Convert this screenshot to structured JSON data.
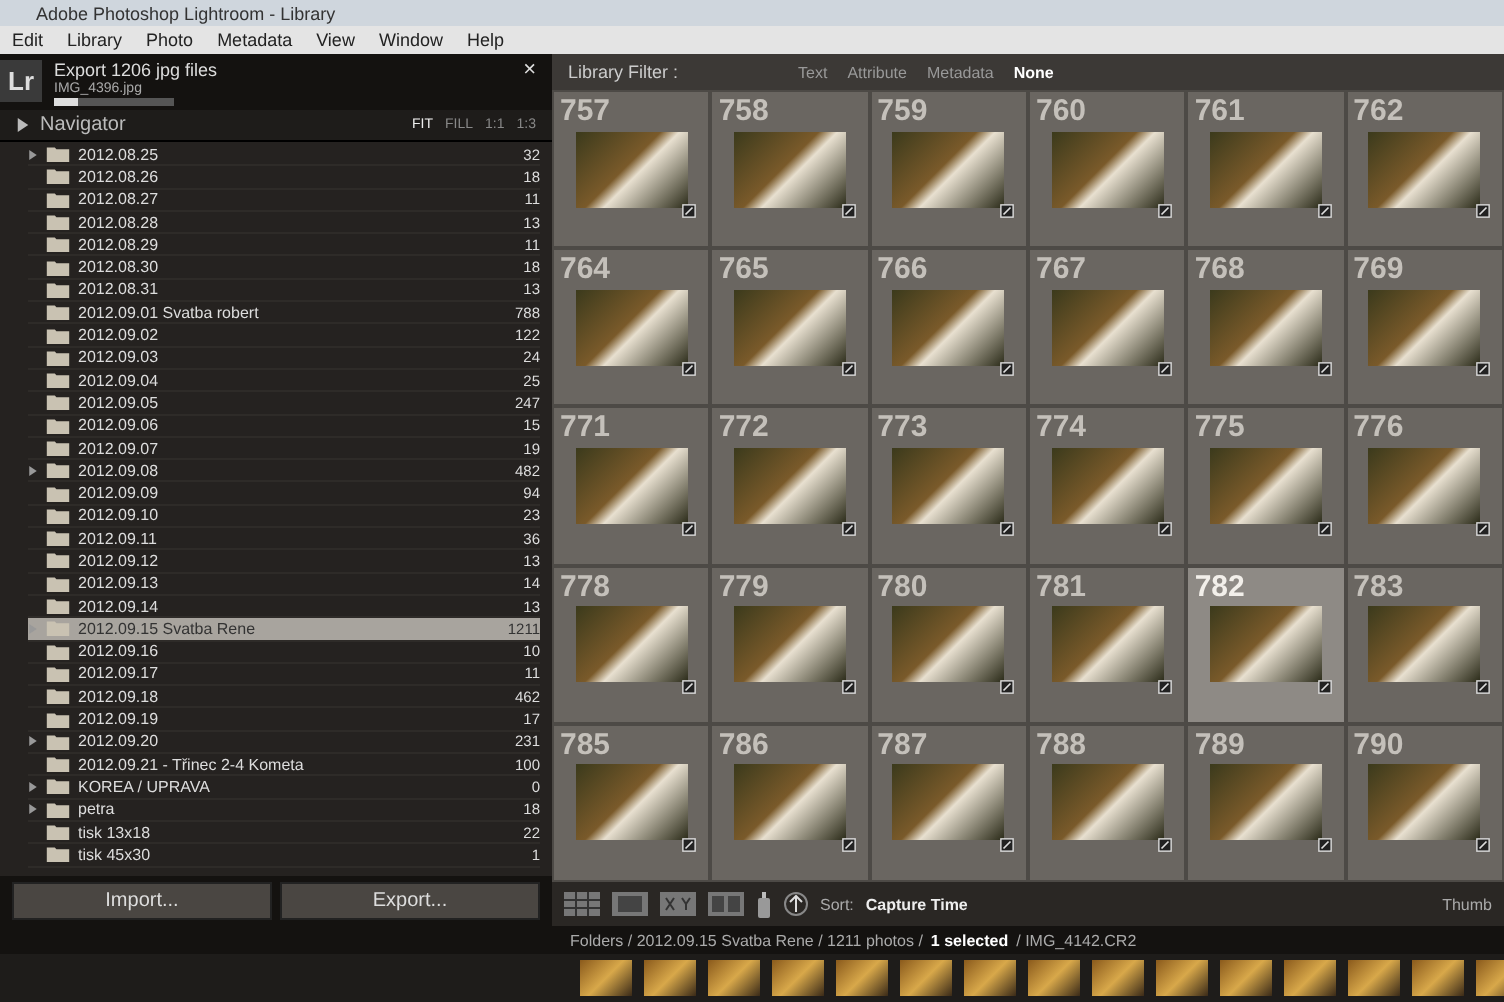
{
  "window": {
    "title": "Adobe Photoshop Lightroom - Library"
  },
  "menu": [
    "Edit",
    "Library",
    "Photo",
    "Metadata",
    "View",
    "Window",
    "Help"
  ],
  "activity": {
    "logo": "Lr",
    "title": "Export 1206 jpg files",
    "file": "IMG_4396.jpg",
    "level": 0.2,
    "close": "×"
  },
  "navigator": {
    "title": "Navigator",
    "expanded": false,
    "zoom_options": [
      {
        "label": "FIT",
        "selected": true
      },
      {
        "label": "FILL",
        "selected": false
      },
      {
        "label": "1:1",
        "selected": false
      },
      {
        "label": "1:3",
        "selected": false
      }
    ]
  },
  "folders": [
    {
      "name": "2012.08.25",
      "count": "32",
      "selected": false,
      "has_children": true
    },
    {
      "name": "2012.08.26",
      "count": "18",
      "selected": false,
      "has_children": false
    },
    {
      "name": "2012.08.27",
      "count": "11",
      "selected": false,
      "has_children": false
    },
    {
      "name": "2012.08.28",
      "count": "13",
      "selected": false,
      "has_children": false
    },
    {
      "name": "2012.08.29",
      "count": "11",
      "selected": false,
      "has_children": false
    },
    {
      "name": "2012.08.30",
      "count": "18",
      "selected": false,
      "has_children": false
    },
    {
      "name": "2012.08.31",
      "count": "13",
      "selected": false,
      "has_children": false
    },
    {
      "name": "2012.09.01 Svatba robert",
      "count": "788",
      "selected": false,
      "has_children": false
    },
    {
      "name": "2012.09.02",
      "count": "122",
      "selected": false,
      "has_children": false
    },
    {
      "name": "2012.09.03",
      "count": "24",
      "selected": false,
      "has_children": false
    },
    {
      "name": "2012.09.04",
      "count": "25",
      "selected": false,
      "has_children": false
    },
    {
      "name": "2012.09.05",
      "count": "247",
      "selected": false,
      "has_children": false
    },
    {
      "name": "2012.09.06",
      "count": "15",
      "selected": false,
      "has_children": false
    },
    {
      "name": "2012.09.07",
      "count": "19",
      "selected": false,
      "has_children": false
    },
    {
      "name": "2012.09.08",
      "count": "482",
      "selected": false,
      "has_children": true
    },
    {
      "name": "2012.09.09",
      "count": "94",
      "selected": false,
      "has_children": false
    },
    {
      "name": "2012.09.10",
      "count": "23",
      "selected": false,
      "has_children": false
    },
    {
      "name": "2012.09.11",
      "count": "36",
      "selected": false,
      "has_children": false
    },
    {
      "name": "2012.09.12",
      "count": "13",
      "selected": false,
      "has_children": false
    },
    {
      "name": "2012.09.13",
      "count": "14",
      "selected": false,
      "has_children": false
    },
    {
      "name": "2012.09.14",
      "count": "13",
      "selected": false,
      "has_children": false
    },
    {
      "name": "2012.09.15 Svatba Rene",
      "count": "1211",
      "selected": true,
      "has_children": true
    },
    {
      "name": "2012.09.16",
      "count": "10",
      "selected": false,
      "has_children": false
    },
    {
      "name": "2012.09.17",
      "count": "11",
      "selected": false,
      "has_children": false
    },
    {
      "name": "2012.09.18",
      "count": "462",
      "selected": false,
      "has_children": false
    },
    {
      "name": "2012.09.19",
      "count": "17",
      "selected": false,
      "has_children": false
    },
    {
      "name": "2012.09.20",
      "count": "231",
      "selected": false,
      "has_children": true
    },
    {
      "name": "2012.09.21 - Třinec 2-4 Kometa",
      "count": "100",
      "selected": false,
      "has_children": false
    },
    {
      "name": "KOREA / UPRAVA",
      "count": "0",
      "selected": false,
      "has_children": true
    },
    {
      "name": "petra",
      "count": "18",
      "selected": false,
      "has_children": true
    },
    {
      "name": "tisk 13x18",
      "count": "22",
      "selected": false,
      "has_children": false
    },
    {
      "name": "tisk 45x30",
      "count": "1",
      "selected": false,
      "has_children": false
    }
  ],
  "panel_buttons": [
    "Import...",
    "Export..."
  ],
  "library_filter": {
    "label": "Library Filter :",
    "options": [
      {
        "label": "Text",
        "selected": false
      },
      {
        "label": "Attribute",
        "selected": false
      },
      {
        "label": "Metadata",
        "selected": false
      },
      {
        "label": "None",
        "selected": true
      }
    ]
  },
  "grid": [
    {
      "number": "757",
      "selected": false
    },
    {
      "number": "758",
      "selected": false
    },
    {
      "number": "759",
      "selected": false
    },
    {
      "number": "760",
      "selected": false
    },
    {
      "number": "761",
      "selected": false
    },
    {
      "number": "762",
      "selected": false
    },
    {
      "number": "764",
      "selected": false
    },
    {
      "number": "765",
      "selected": false
    },
    {
      "number": "766",
      "selected": false
    },
    {
      "number": "767",
      "selected": false
    },
    {
      "number": "768",
      "selected": false
    },
    {
      "number": "769",
      "selected": false
    },
    {
      "number": "771",
      "selected": false
    },
    {
      "number": "772",
      "selected": false
    },
    {
      "number": "773",
      "selected": false
    },
    {
      "number": "774",
      "selected": false
    },
    {
      "number": "775",
      "selected": false
    },
    {
      "number": "776",
      "selected": false
    },
    {
      "number": "778",
      "selected": false
    },
    {
      "number": "779",
      "selected": false
    },
    {
      "number": "780",
      "selected": false
    },
    {
      "number": "781",
      "selected": false
    },
    {
      "number": "782",
      "selected": true
    },
    {
      "number": "783",
      "selected": false
    },
    {
      "number": "785",
      "selected": false
    },
    {
      "number": "786",
      "selected": false
    },
    {
      "number": "787",
      "selected": false
    },
    {
      "number": "788",
      "selected": false
    },
    {
      "number": "789",
      "selected": false
    },
    {
      "number": "790",
      "selected": false
    }
  ],
  "toolbar": {
    "sort_label": "Sort:",
    "sort_value": "Capture Time",
    "thumbnails_label": "Thumb"
  },
  "status_bar": {
    "path": "Folders / 2012.09.15 Svatba Rene / 1211 photos /",
    "selection": "1 selected",
    "file": "/ IMG_4142.CR2"
  }
}
